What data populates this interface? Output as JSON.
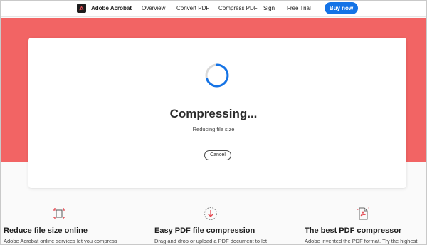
{
  "nav": {
    "brand": "Adobe Acrobat",
    "links": [
      "Overview",
      "Convert PDF",
      "Compress PDF",
      "Sign",
      "Free Trial"
    ],
    "buy_label": "Buy now"
  },
  "card": {
    "title": "Compressing...",
    "subtitle": "Reducing file size",
    "cancel_label": "Cancel"
  },
  "features": [
    {
      "icon": "reduce-size-icon",
      "title": "Reduce file size online",
      "text": "Adobe Acrobat online services let you compress"
    },
    {
      "icon": "upload-arrow-icon",
      "title": "Easy PDF file compression",
      "text": "Drag and drop or upload a PDF document to let"
    },
    {
      "icon": "pdf-document-icon",
      "title": "The best PDF compressor",
      "text": "Adobe invented the PDF format. Try the highest"
    }
  ],
  "colors": {
    "accent": "#1473e6",
    "hero": "#f26464",
    "feature_icon": "#e34850"
  }
}
